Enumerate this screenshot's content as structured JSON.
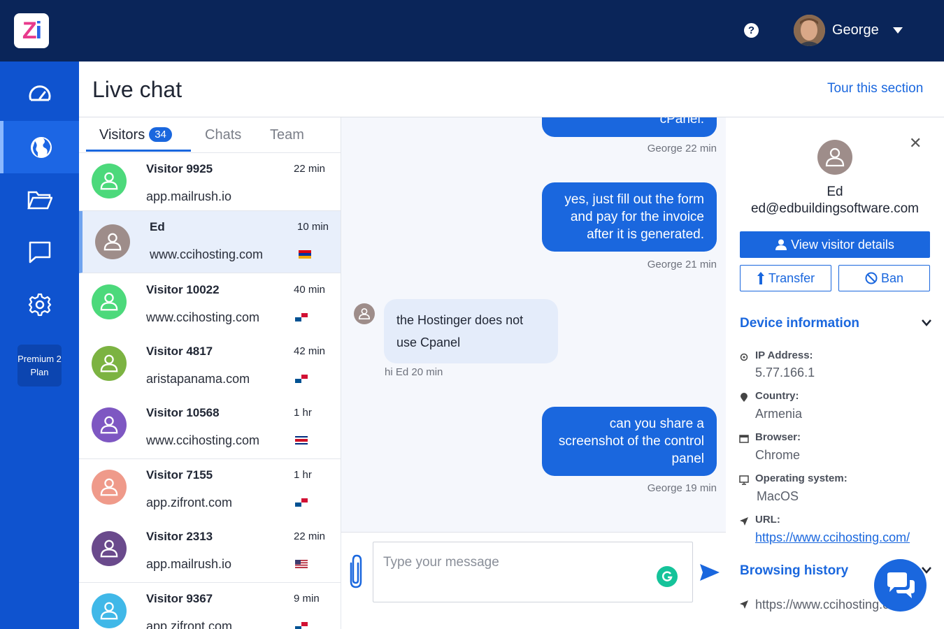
{
  "app": {
    "logo_z": "Z",
    "logo_i": "i"
  },
  "topbar": {
    "help": "?",
    "user_name": "George"
  },
  "sidebar": {
    "plan_line1": "Premium 2",
    "plan_line2": "Plan"
  },
  "page": {
    "title": "Live chat",
    "tour_link": "Tour this section"
  },
  "tabs": {
    "visitors": "Visitors",
    "visitors_count": "34",
    "chats": "Chats",
    "team": "Team"
  },
  "visitors": [
    {
      "name": "Visitor 9925",
      "time": "22 min",
      "site": "app.mailrush.io",
      "avatar_color": "#4cd97b",
      "flag": "none"
    },
    {
      "name": "Ed",
      "time": "10 min",
      "site": "www.ccihosting.com",
      "avatar_color": "#9e8d8a",
      "flag": "armenia"
    },
    {
      "name": "Visitor 10022",
      "time": "40 min",
      "site": "www.ccihosting.com",
      "avatar_color": "#4cd97b",
      "flag": "panama"
    },
    {
      "name": "Visitor 4817",
      "time": "42 min",
      "site": "aristapanama.com",
      "avatar_color": "#7cb342",
      "flag": "panama"
    },
    {
      "name": "Visitor 10568",
      "time": "1 hr",
      "site": "www.ccihosting.com",
      "avatar_color": "#7e57c2",
      "flag": "costa-rica"
    },
    {
      "name": "Visitor 7155",
      "time": "1 hr",
      "site": "app.zifront.com",
      "avatar_color": "#ef9a8a",
      "flag": "panama"
    },
    {
      "name": "Visitor 2313",
      "time": "22 min",
      "site": "app.mailrush.io",
      "avatar_color": "#6a4a8c",
      "flag": "usa"
    },
    {
      "name": "Visitor 9367",
      "time": "9 min",
      "site": "app.zifront.com",
      "avatar_color": "#40b8e8",
      "flag": "panama"
    }
  ],
  "messages": [
    {
      "type": "out",
      "text": "cPanel.",
      "meta": "George 22 min"
    },
    {
      "type": "out",
      "text": "yes, just fill out the form and pay for the invoice after it is generated.",
      "meta": "George 21 min"
    },
    {
      "type": "in",
      "text": "the Hostinger does not use Cpanel",
      "meta": "hi Ed 20 min"
    },
    {
      "type": "out",
      "text": "can you share a screenshot of the control panel",
      "meta": "George 19 min"
    }
  ],
  "composer": {
    "placeholder": "Type your message"
  },
  "visitor_detail": {
    "name": "Ed",
    "email": "ed@edbuildingsoftware.com",
    "view_details_label": "View visitor details",
    "transfer_label": "Transfer",
    "ban_label": "Ban",
    "device_section": "Device information",
    "ip_label": "IP Address:",
    "ip_value": "5.77.166.1",
    "country_label": "Country:",
    "country_value": "Armenia",
    "browser_label": "Browser:",
    "browser_value": "Chrome",
    "os_label": "Operating system:",
    "os_value": "MacOS",
    "url_label": "URL:",
    "url_value": "https://www.ccihosting.com/",
    "history_section": "Browsing history",
    "history_item": "https://www.ccihosting.com/"
  },
  "colors": {
    "topbar": "#0a2559",
    "sidebar": "#0f53cf",
    "accent": "#1a67de"
  }
}
